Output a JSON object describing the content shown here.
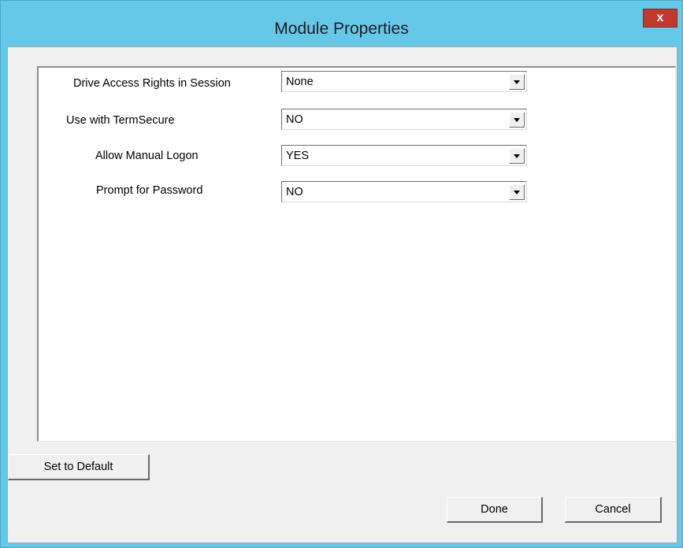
{
  "window": {
    "title": "Module Properties",
    "close_label": "x"
  },
  "properties": [
    {
      "label": "Drive Access Rights in Session",
      "value": "None"
    },
    {
      "label": "Use with TermSecure",
      "value": "NO"
    },
    {
      "label": "Allow Manual Logon",
      "value": "YES"
    },
    {
      "label": "Prompt for Password",
      "value": "NO"
    }
  ],
  "buttons": {
    "set_default": "Set to Default",
    "done": "Done",
    "cancel": "Cancel"
  },
  "colors": {
    "title_bar": "#66c8e9",
    "close_button": "#c0392b",
    "client_background": "#f0f0f0"
  }
}
